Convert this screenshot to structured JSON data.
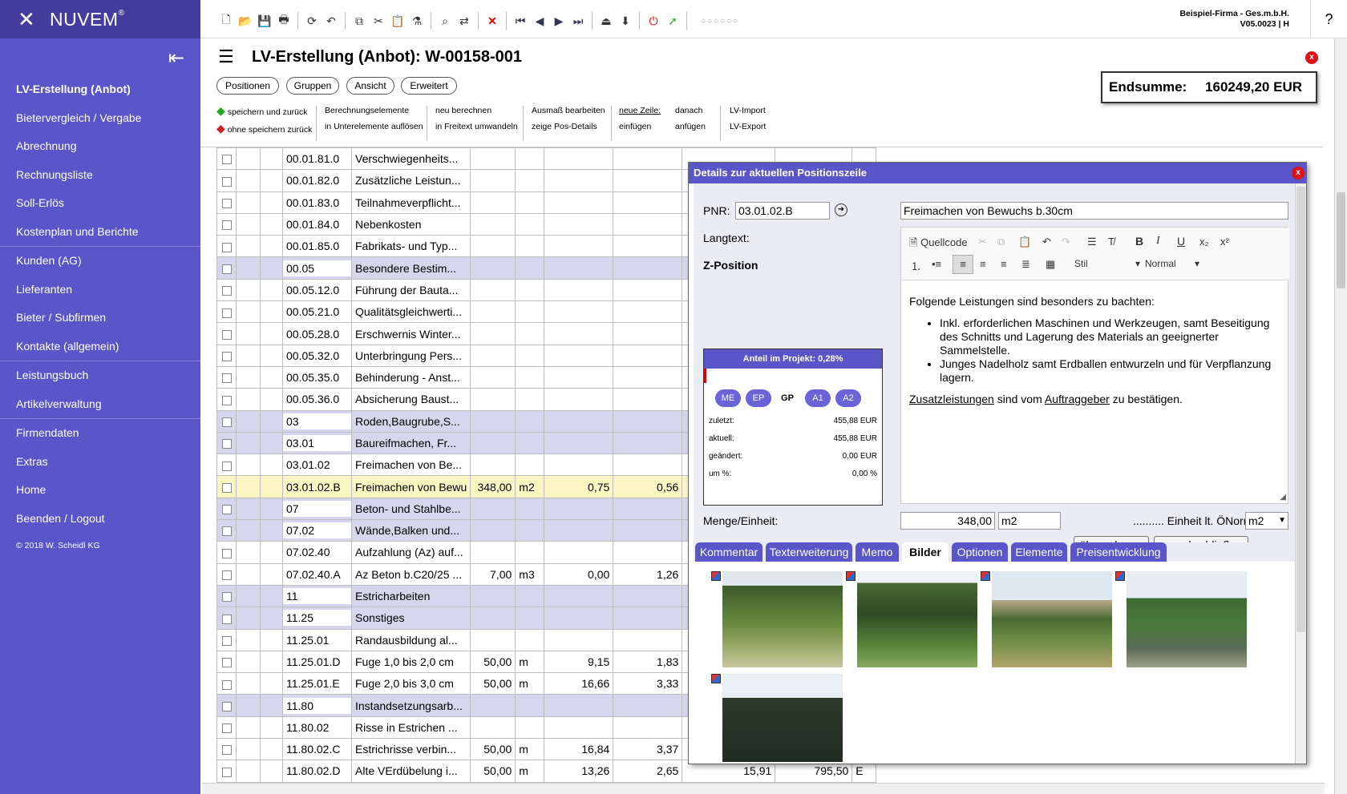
{
  "brand": {
    "logo": "✕",
    "name": "NUVEM",
    "reg": "®"
  },
  "sidebar": {
    "items": [
      {
        "label": "LV-Erstellung (Anbot)",
        "active": true
      },
      {
        "label": "Bietervergleich / Vergabe"
      },
      {
        "label": "Abrechnung"
      },
      {
        "label": "Rechnungsliste"
      },
      {
        "label": "Soll-Erlös"
      },
      {
        "label": "Kostenplan und Berichte"
      },
      {
        "label": "Kunden (AG)"
      },
      {
        "label": "Lieferanten"
      },
      {
        "label": "Bieter / Subfirmen"
      },
      {
        "label": "Kontakte (allgemein)"
      },
      {
        "label": "Leistungsbuch"
      },
      {
        "label": "Artikelverwaltung"
      },
      {
        "label": "Firmendaten"
      },
      {
        "label": "Extras"
      },
      {
        "label": "Home"
      },
      {
        "label": "Beenden / Logout"
      }
    ],
    "copyright": "© 2018 W. Scheidl KG"
  },
  "toolbar": {
    "company": "Beispiel-Firma - Ges.m.b.H.",
    "version": "V05.0023 | H",
    "help": "?",
    "dots": "○○○○○○"
  },
  "page": {
    "title": "LV-Erstellung (Anbot): W-00158-001",
    "close": "x"
  },
  "tabs": [
    "Positionen",
    "Gruppen",
    "Ansicht",
    "Erweitert"
  ],
  "total": {
    "label": "Endsumme:",
    "value": "160249,20 EUR"
  },
  "actions": {
    "save_back": "speichern und zurück",
    "nosave_back": "ohne speichern zurück",
    "calc_elements": "Berechnungselemente",
    "dissolve": "in Unterelemente auflösen",
    "recalc": "neu berechnen",
    "to_freetext": "in Freitext umwandeln",
    "edit_measure": "Ausmaß bearbeiten",
    "show_details": "zeige Pos-Details",
    "new_row": "neue Zeile:",
    "insert": "einfügen",
    "after": "danach",
    "append": "anfügen",
    "import": "LV-Import",
    "export": "LV-Export"
  },
  "grid": {
    "rows": [
      {
        "pnr": "00.01.81.0",
        "text": "Verschwiegenheits...",
        "qty": "",
        "unit": "",
        "ep": "",
        "gp": ""
      },
      {
        "pnr": "00.01.82.0",
        "text": "Zusätzliche Leistun...",
        "qty": "",
        "unit": "",
        "ep": "",
        "gp": ""
      },
      {
        "pnr": "00.01.83.0",
        "text": "Teilnahmeverpflicht...",
        "qty": "",
        "unit": "",
        "ep": "",
        "gp": ""
      },
      {
        "pnr": "00.01.84.0",
        "text": "Nebenkosten",
        "qty": "",
        "unit": "",
        "ep": "",
        "gp": ""
      },
      {
        "pnr": "00.01.85.0",
        "text": "Fabrikats- und Typ...",
        "qty": "",
        "unit": "",
        "ep": "",
        "gp": ""
      },
      {
        "pnr": "00.05",
        "text": "Besondere Bestim...",
        "qty": "",
        "unit": "",
        "ep": "",
        "gp": "",
        "group": true
      },
      {
        "pnr": "00.05.12.0",
        "text": "Führung der Bauta...",
        "qty": "",
        "unit": "",
        "ep": "",
        "gp": ""
      },
      {
        "pnr": "00.05.21.0",
        "text": "Qualitätsgleichwerti...",
        "qty": "",
        "unit": "",
        "ep": "",
        "gp": ""
      },
      {
        "pnr": "00.05.28.0",
        "text": "Erschwernis Winter...",
        "qty": "",
        "unit": "",
        "ep": "",
        "gp": ""
      },
      {
        "pnr": "00.05.32.0",
        "text": "Unterbringung Pers...",
        "qty": "",
        "unit": "",
        "ep": "",
        "gp": ""
      },
      {
        "pnr": "00.05.35.0",
        "text": "Behinderung - Anst...",
        "qty": "",
        "unit": "",
        "ep": "",
        "gp": ""
      },
      {
        "pnr": "00.05.36.0",
        "text": "Absicherung Baust...",
        "qty": "",
        "unit": "",
        "ep": "",
        "gp": ""
      },
      {
        "pnr": "03",
        "text": "Roden,Baugrube,S...",
        "qty": "",
        "unit": "",
        "ep": "",
        "gp": "",
        "group": true
      },
      {
        "pnr": "03.01",
        "text": "Baureifmachen, Fr...",
        "qty": "",
        "unit": "",
        "ep": "",
        "gp": "",
        "group": true
      },
      {
        "pnr": "03.01.02",
        "text": "Freimachen von Be...",
        "qty": "",
        "unit": "",
        "ep": "",
        "gp": ""
      },
      {
        "pnr": "03.01.02.B",
        "text": "Freimachen von Bewu",
        "qty": "348,00",
        "unit": "m2",
        "ep": "0,75",
        "gp": "0,56",
        "selected": true
      },
      {
        "pnr": "07",
        "text": "Beton- und Stahlbe...",
        "qty": "",
        "unit": "",
        "ep": "",
        "gp": "",
        "group": true
      },
      {
        "pnr": "07.02",
        "text": "Wände,Balken und...",
        "qty": "",
        "unit": "",
        "ep": "",
        "gp": "",
        "group": true
      },
      {
        "pnr": "07.02.40",
        "text": "Aufzahlung (Az) auf...",
        "qty": "",
        "unit": "",
        "ep": "",
        "gp": ""
      },
      {
        "pnr": "07.02.40.A",
        "text": "Az Beton b.C20/25 ...",
        "qty": "7,00",
        "unit": "m3",
        "ep": "0,00",
        "gp": "1,26"
      },
      {
        "pnr": "11",
        "text": "Estricharbeiten",
        "qty": "",
        "unit": "",
        "ep": "",
        "gp": "",
        "group": true
      },
      {
        "pnr": "11.25",
        "text": "Sonstiges",
        "qty": "",
        "unit": "",
        "ep": "",
        "gp": "",
        "group": true
      },
      {
        "pnr": "11.25.01",
        "text": "Randausbildung al...",
        "qty": "",
        "unit": "",
        "ep": "",
        "gp": ""
      },
      {
        "pnr": "11.25.01.D",
        "text": "Fuge 1,0 bis 2,0 cm",
        "qty": "50,00",
        "unit": "m",
        "ep": "9,15",
        "gp": "1,83"
      },
      {
        "pnr": "11.25.01.E",
        "text": "Fuge 2,0 bis 3,0 cm",
        "qty": "50,00",
        "unit": "m",
        "ep": "16,66",
        "gp": "3,33"
      },
      {
        "pnr": "11.80",
        "text": "Instandsetzungsarb...",
        "qty": "",
        "unit": "",
        "ep": "",
        "gp": "",
        "group": true
      },
      {
        "pnr": "11.80.02",
        "text": "Risse in Estrichen ...",
        "qty": "",
        "unit": "",
        "ep": "",
        "gp": ""
      },
      {
        "pnr": "11.80.02.C",
        "text": "Estrichrisse verbin...",
        "qty": "50,00",
        "unit": "m",
        "ep": "16,84",
        "gp": "3,37"
      },
      {
        "pnr": "11.80.02.D",
        "text": "Alte VErdübelung i...",
        "qty": "50,00",
        "unit": "m",
        "ep": "13,26",
        "gp": "2,65",
        "extra1": "15,91",
        "extra2": "795,50",
        "extra3": "E"
      }
    ]
  },
  "dialog": {
    "title": "Details zur aktuellen Positionszeile",
    "close": "x",
    "pnr_label": "PNR:",
    "pnr_value": "03.01.02.B",
    "short_text": "Freimachen von Bewuchs b.30cm",
    "langtext_label": "Langtext:",
    "type_label": "Z-Position",
    "editor": {
      "source": "Quellcode",
      "style": "Stil",
      "format": "Normal",
      "intro": "Folgende Leistungen sind besonders zu bachten:",
      "bullets": [
        "Inkl. erforderlichen Maschinen und Werkzeugen, samt Beseitigung des Schnitts und Lagerung des Materials an geeignerter Sammelstelle.",
        "Junges Nadelholz samt Erdballen entwurzeln und für Verpflanzung lagern."
      ],
      "outro_1": "Zusatzleistungen",
      "outro_2": " sind vom ",
      "outro_3": "Auftraggeber",
      "outro_4": " zu bestätigen."
    },
    "share": {
      "head": "Anteil im Projekt: 0,28%",
      "buttons": [
        "ME",
        "EP",
        "GP",
        "A1",
        "A2"
      ],
      "last_label": "zuletzt:",
      "last_value": "455,88 EUR",
      "current_label": "aktuell:",
      "current_value": "455,88 EUR",
      "changed_label": "geändert:",
      "changed_value": "0,00 EUR",
      "pct_label": "um %:",
      "pct_value": "0,00 %"
    },
    "qty_label": "Menge/Einheit:",
    "qty_value": "348,00",
    "unit_value": "m2",
    "norm_label": ".......... Einheit lt. ÖNorm:",
    "norm_value": "m2",
    "btn_apply": "übernehmen",
    "btn_apply_close": "... und schließen",
    "tabs": [
      "Kommentar",
      "Texterweiterung",
      "Memo",
      "Bilder",
      "Optionen",
      "Elemente",
      "Preisentwicklung"
    ]
  }
}
